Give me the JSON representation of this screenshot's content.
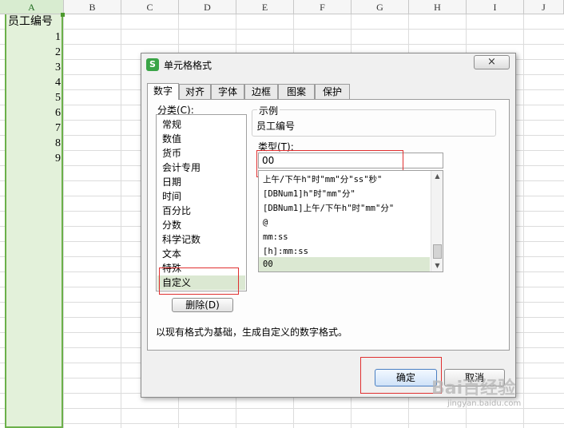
{
  "sheet": {
    "columns": [
      "A",
      "B",
      "C",
      "D",
      "E",
      "F",
      "G",
      "H",
      "I",
      "J"
    ],
    "header_cell": "员工编号",
    "rows": [
      "1",
      "2",
      "3",
      "4",
      "5",
      "6",
      "7",
      "8",
      "9"
    ]
  },
  "dialog": {
    "title": "单元格格式",
    "close": "×",
    "tabs": [
      "数字",
      "对齐",
      "字体",
      "边框",
      "图案",
      "保护"
    ],
    "category_label": "分类(C):",
    "categories": [
      "常规",
      "数值",
      "货币",
      "会计专用",
      "日期",
      "时间",
      "百分比",
      "分数",
      "科学记数",
      "文本",
      "特殊",
      "自定义"
    ],
    "selected_category": "自定义",
    "sample_legend": "示例",
    "sample_value": "员工编号",
    "type_label": "类型(T):",
    "type_value": "00",
    "type_list": [
      "上午/下午h\"时\"mm\"分\"ss\"秒\"",
      "[DBNum1]h\"时\"mm\"分\"",
      "[DBNum1]上午/下午h\"时\"mm\"分\"",
      "@",
      "mm:ss",
      "[h]:mm:ss",
      "00"
    ],
    "delete_label": "删除(D)",
    "description": "以现有格式为基础，生成自定义的数字格式。",
    "ok_label": "确定",
    "cancel_label": "取消"
  },
  "watermark": {
    "brand": "Bai百经验",
    "url": "jingyan.baidu.com"
  },
  "colors": {
    "selection_green": "#6bb04a",
    "highlight_red": "#e03030",
    "app_icon": "#3aa447"
  }
}
